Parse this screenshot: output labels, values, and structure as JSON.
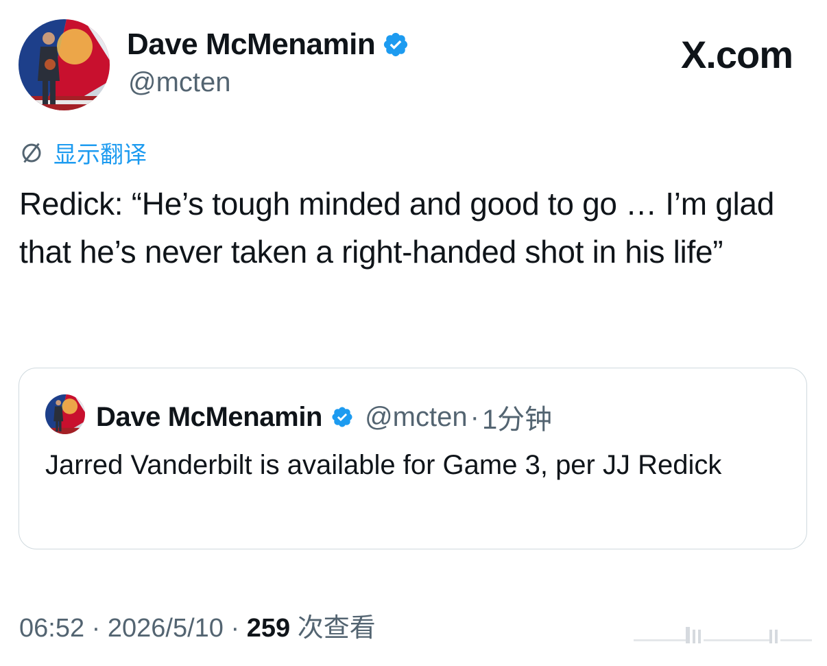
{
  "brand": {
    "label": "X.com"
  },
  "author": {
    "name": "Dave McMenamin",
    "handle": "@mcten",
    "verified_color": "#1d9bf0",
    "avatar_icon": "profile-photo"
  },
  "translate": {
    "label": "显示翻译",
    "icon": "globe-slash-icon"
  },
  "tweet": {
    "text": "Redick: “He’s tough minded and good to go … I’m glad that he’s never taken a right-handed shot in his life”"
  },
  "quoted_tweet": {
    "name": "Dave McMenamin",
    "handle": "@mcten",
    "separator": "·",
    "time": "1分钟",
    "text": "Jarred Vanderbilt is available for Game 3, per JJ Redick"
  },
  "footer": {
    "time": "06:52",
    "separator": "·",
    "date": "2026/5/10",
    "views_count": "259",
    "views_label": "次查看"
  },
  "colors": {
    "accent": "#1d9bf0",
    "text": "#0f1419",
    "secondary": "#536471",
    "border": "#cfd9de"
  }
}
